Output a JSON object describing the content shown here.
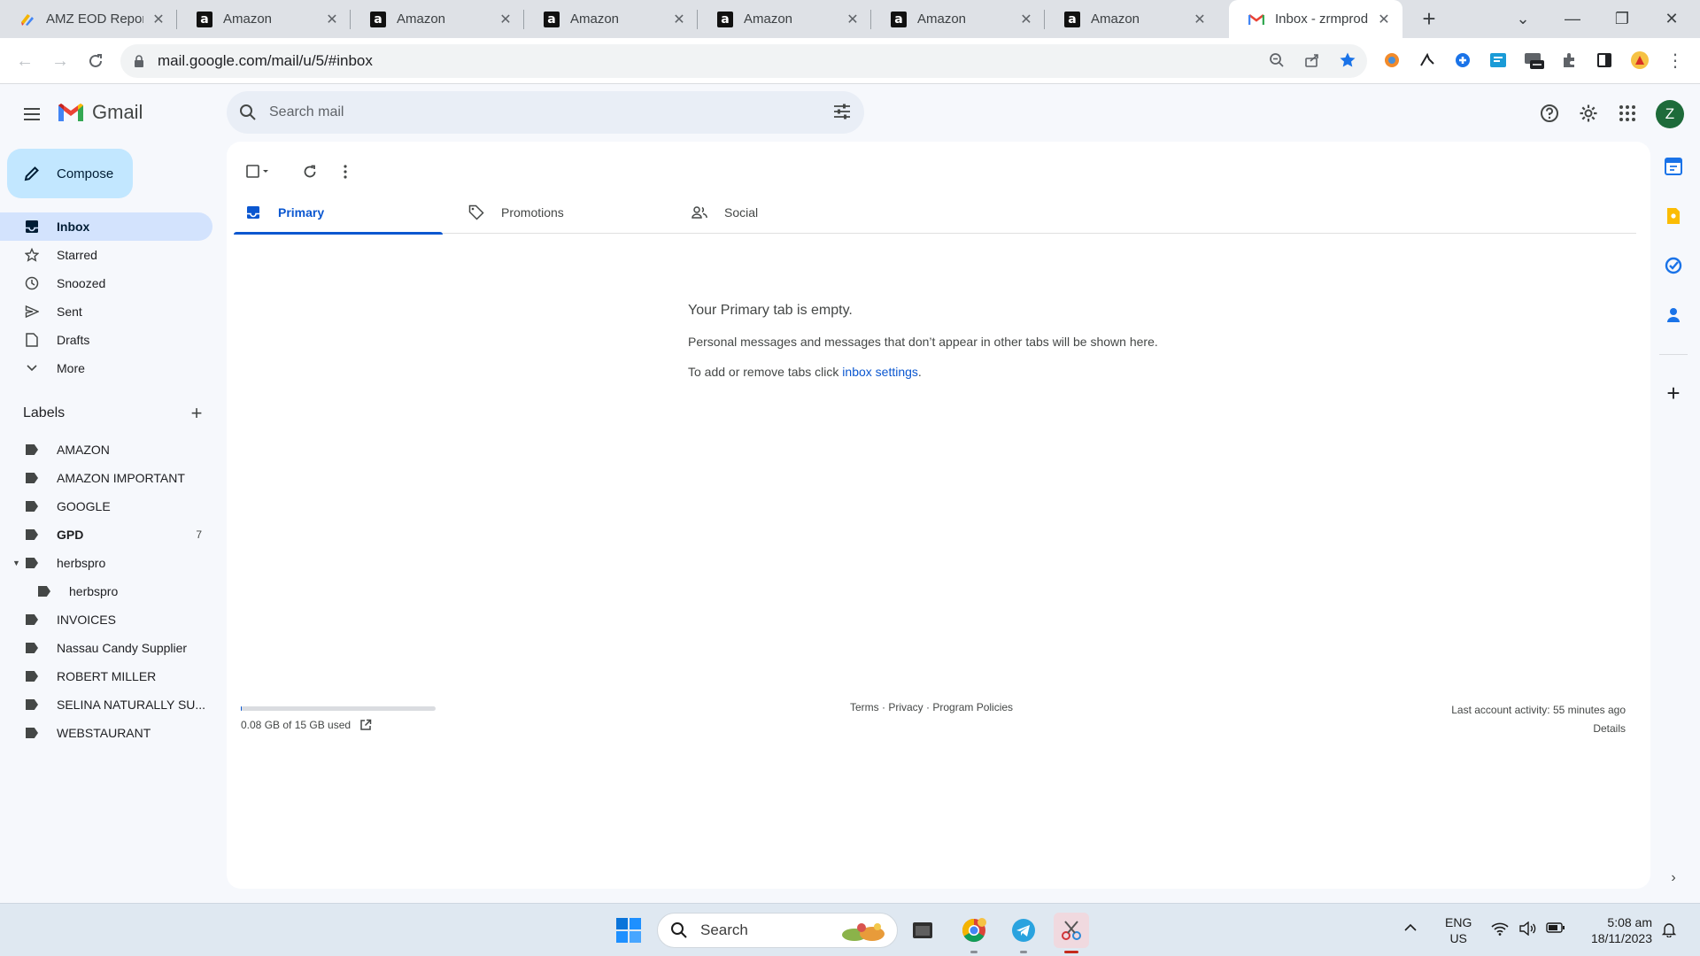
{
  "browser": {
    "tabs": [
      {
        "title": "AMZ EOD Report",
        "favicon": "apps-script-icon"
      },
      {
        "title": "Amazon",
        "favicon": "amazon-icon"
      },
      {
        "title": "Amazon",
        "favicon": "amazon-icon"
      },
      {
        "title": "Amazon",
        "favicon": "amazon-icon"
      },
      {
        "title": "Amazon",
        "favicon": "amazon-icon"
      },
      {
        "title": "Amazon",
        "favicon": "amazon-icon"
      },
      {
        "title": "Amazon",
        "favicon": "amazon-icon"
      },
      {
        "title": "Inbox - zrmprod",
        "favicon": "gmail-icon",
        "active": true
      }
    ],
    "url": "mail.google.com/mail/u/5/#inbox"
  },
  "gmail": {
    "app_name": "Gmail",
    "search_placeholder": "Search mail",
    "account_initial": "Z",
    "compose_label": "Compose",
    "nav": [
      {
        "label": "Inbox",
        "icon": "inbox-icon",
        "active": true
      },
      {
        "label": "Starred",
        "icon": "star-icon"
      },
      {
        "label": "Snoozed",
        "icon": "clock-icon"
      },
      {
        "label": "Sent",
        "icon": "send-icon"
      },
      {
        "label": "Drafts",
        "icon": "draft-icon"
      },
      {
        "label": "More",
        "icon": "chevron-down-icon"
      }
    ],
    "labels_title": "Labels",
    "labels": [
      {
        "label": "AMAZON"
      },
      {
        "label": "AMAZON IMPORTANT"
      },
      {
        "label": "GOOGLE"
      },
      {
        "label": "GPD",
        "count": "7",
        "bold": true
      },
      {
        "label": "herbspro",
        "expanded": true
      },
      {
        "label": "herbspro",
        "nested": true
      },
      {
        "label": "INVOICES"
      },
      {
        "label": "Nassau Candy Supplier"
      },
      {
        "label": "ROBERT MILLER"
      },
      {
        "label": "SELINA NATURALLY SU..."
      },
      {
        "label": "WEBSTAURANT"
      }
    ],
    "inbox_tabs": [
      {
        "label": "Primary",
        "active": true
      },
      {
        "label": "Promotions"
      },
      {
        "label": "Social"
      }
    ],
    "empty_state": {
      "heading": "Your Primary tab is empty.",
      "line1": "Personal messages and messages that don’t appear in other tabs will be shown here.",
      "line2_prefix": "To add or remove tabs click ",
      "line2_link": "inbox settings",
      "line2_suffix": "."
    },
    "storage": {
      "text": "0.08 GB of 15 GB used",
      "fraction": 0.005
    },
    "footer": {
      "terms": "Terms",
      "privacy": "Privacy",
      "policies": "Program Policies",
      "activity": "Last account activity: 55 minutes ago",
      "details": "Details"
    }
  },
  "taskbar": {
    "search_label": "Search",
    "language": "ENG",
    "region": "US",
    "time": "5:08 am",
    "date": "18/11/2023"
  },
  "colors": {
    "accent": "#0b57d0",
    "compose_bg": "#c2e7ff",
    "active_nav": "#d3e3fd",
    "background": "#f6f8fc"
  }
}
